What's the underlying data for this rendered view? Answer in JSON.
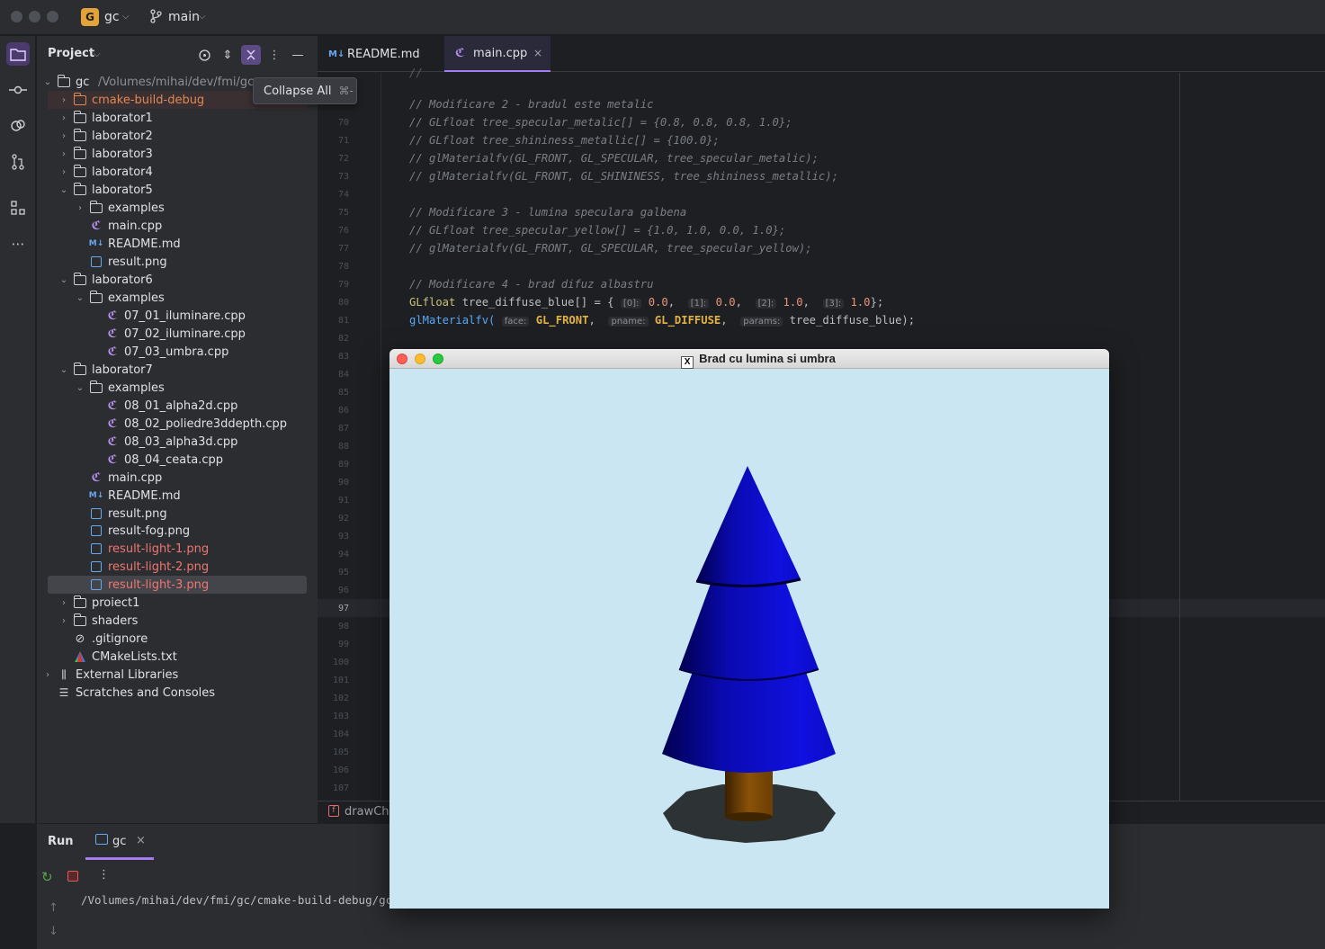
{
  "titlebar": {
    "project_badge": "G",
    "project_name": "gc",
    "branch": "main"
  },
  "project_panel": {
    "title": "Project",
    "tooltip": {
      "label": "Collapse All",
      "shortcut": "⌘-"
    },
    "root": {
      "name": "gc",
      "path": "/Volumes/mihai/dev/fmi/gc"
    },
    "tree": [
      {
        "label": "cmake-build-debug",
        "depth": 1,
        "arrow": "›",
        "icon": "folder-orange",
        "color": "orange"
      },
      {
        "label": "laborator1",
        "depth": 1,
        "arrow": "›",
        "icon": "folder"
      },
      {
        "label": "laborator2",
        "depth": 1,
        "arrow": "›",
        "icon": "folder"
      },
      {
        "label": "laborator3",
        "depth": 1,
        "arrow": "›",
        "icon": "folder"
      },
      {
        "label": "laborator4",
        "depth": 1,
        "arrow": "›",
        "icon": "folder"
      },
      {
        "label": "laborator5",
        "depth": 1,
        "arrow": "⌄",
        "icon": "folder"
      },
      {
        "label": "examples",
        "depth": 2,
        "arrow": "›",
        "icon": "folder"
      },
      {
        "label": "main.cpp",
        "depth": 2,
        "arrow": "",
        "icon": "cpp"
      },
      {
        "label": "README.md",
        "depth": 2,
        "arrow": "",
        "icon": "md"
      },
      {
        "label": "result.png",
        "depth": 2,
        "arrow": "",
        "icon": "png"
      },
      {
        "label": "laborator6",
        "depth": 1,
        "arrow": "⌄",
        "icon": "folder"
      },
      {
        "label": "examples",
        "depth": 2,
        "arrow": "⌄",
        "icon": "folder"
      },
      {
        "label": "07_01_iluminare.cpp",
        "depth": 3,
        "arrow": "",
        "icon": "cpp"
      },
      {
        "label": "07_02_iluminare.cpp",
        "depth": 3,
        "arrow": "",
        "icon": "cpp"
      },
      {
        "label": "07_03_umbra.cpp",
        "depth": 3,
        "arrow": "",
        "icon": "cpp"
      },
      {
        "label": "laborator7",
        "depth": 1,
        "arrow": "⌄",
        "icon": "folder"
      },
      {
        "label": "examples",
        "depth": 2,
        "arrow": "⌄",
        "icon": "folder"
      },
      {
        "label": "08_01_alpha2d.cpp",
        "depth": 3,
        "arrow": "",
        "icon": "cpp"
      },
      {
        "label": "08_02_poliedre3ddepth.cpp",
        "depth": 3,
        "arrow": "",
        "icon": "cpp"
      },
      {
        "label": "08_03_alpha3d.cpp",
        "depth": 3,
        "arrow": "",
        "icon": "cpp"
      },
      {
        "label": "08_04_ceata.cpp",
        "depth": 3,
        "arrow": "",
        "icon": "cpp"
      },
      {
        "label": "main.cpp",
        "depth": 2,
        "arrow": "",
        "icon": "cpp"
      },
      {
        "label": "README.md",
        "depth": 2,
        "arrow": "",
        "icon": "md"
      },
      {
        "label": "result.png",
        "depth": 2,
        "arrow": "",
        "icon": "png"
      },
      {
        "label": "result-fog.png",
        "depth": 2,
        "arrow": "",
        "icon": "png"
      },
      {
        "label": "result-light-1.png",
        "depth": 2,
        "arrow": "",
        "icon": "png",
        "color": "red"
      },
      {
        "label": "result-light-2.png",
        "depth": 2,
        "arrow": "",
        "icon": "png",
        "color": "red"
      },
      {
        "label": "result-light-3.png",
        "depth": 2,
        "arrow": "",
        "icon": "png",
        "color": "red",
        "selected": true
      },
      {
        "label": "proiect1",
        "depth": 1,
        "arrow": "›",
        "icon": "folder"
      },
      {
        "label": "shaders",
        "depth": 1,
        "arrow": "›",
        "icon": "folder"
      },
      {
        "label": ".gitignore",
        "depth": 1,
        "arrow": "",
        "icon": "ignore"
      },
      {
        "label": "CMakeLists.txt",
        "depth": 1,
        "arrow": "",
        "icon": "cmake"
      },
      {
        "label": "External Libraries",
        "depth": 0,
        "arrow": "›",
        "icon": "libs"
      },
      {
        "label": "Scratches and Consoles",
        "depth": 0,
        "arrow": "",
        "icon": "scratch"
      }
    ]
  },
  "editor": {
    "tabs": [
      {
        "label": "README.md",
        "icon": "md"
      },
      {
        "label": "main.cpp",
        "icon": "cpp",
        "active": true
      }
    ],
    "line_numbers": [
      "70",
      "71",
      "72",
      "73",
      "74",
      "75",
      "76",
      "77",
      "78",
      "79",
      "80",
      "81",
      "82",
      "83",
      "84",
      "85",
      "86",
      "87",
      "88",
      "89",
      "90",
      "91",
      "92",
      "93",
      "94",
      "95",
      "96",
      "97",
      "98",
      "99",
      "100",
      "101",
      "102",
      "103",
      "104",
      "105",
      "106",
      "107"
    ],
    "current_line": "97",
    "code": {
      "l69": "// Modificare 2 - bradul este metalic",
      "l70": "// GLfloat tree_specular_metalic[] = {0.8, 0.8, 0.8, 1.0};",
      "l71": "// GLfloat tree_shininess_metallic[] = {100.0};",
      "l72": "// glMaterialfv(GL_FRONT, GL_SPECULAR, tree_specular_metalic);",
      "l73": "// glMaterialfv(GL_FRONT, GL_SHININESS, tree_shininess_metallic);",
      "l75": "// Modificare 3 - lumina speculara galbena",
      "l76": "// GLfloat tree_specular_yellow[] = {1.0, 1.0, 0.0, 1.0};",
      "l77": "// glMaterialfv(GL_FRONT, GL_SPECULAR, tree_specular_yellow);",
      "l79": "// Modificare 4 - brad difuz albastru",
      "l80_type": "GLfloat",
      "l80_name": " tree_diffuse_blue[] = { ",
      "l80_h0": "[0]:",
      "l80_v0": "0.0",
      "l80_h1": "[1]:",
      "l80_v1": "0.0",
      "l80_h2": "[2]:",
      "l80_v2": "1.0",
      "l80_h3": "[3]:",
      "l80_v3": "1.0",
      "l80_end": "};",
      "l81_fn": "glMaterialfv(",
      "l81_h0": "face:",
      "l81_a0": "GL_FRONT",
      "l81_h1": "pname:",
      "l81_a1": "GL_DIFFUSE",
      "l81_h2": "params:",
      "l81_a2": "tree_diffuse_blue",
      "l81_end": ");"
    },
    "breadcrumb": "drawCh"
  },
  "run_panel": {
    "title": "Run",
    "tab": "gc",
    "output_path": "/Volumes/mihai/dev/fmi/gc/cmake-build-debug/gc"
  },
  "gl_window": {
    "title": "Brad cu lumina si umbra",
    "x_badge": "X",
    "background": "#c9e6f2",
    "tree_color": "#0b0bd0",
    "trunk_color": "#7a4a05"
  }
}
